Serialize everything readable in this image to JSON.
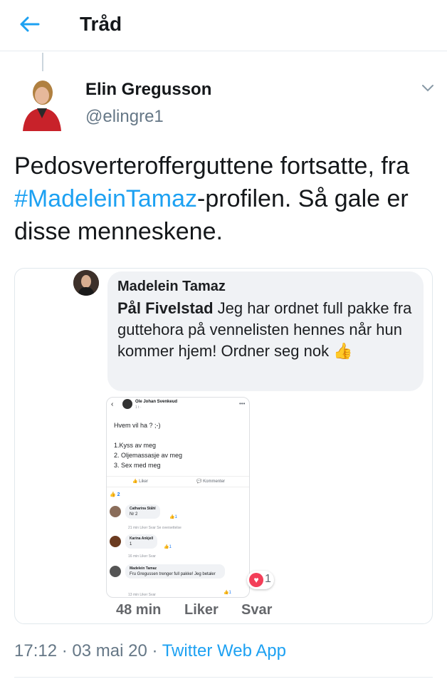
{
  "header": {
    "title": "Tråd",
    "back_icon": "back-arrow-icon"
  },
  "tweet": {
    "author_name": "Elin Gregusson",
    "author_handle": "@elingre1",
    "text_part1": "Pedosverteroffergutten​e fortsatte, fra ",
    "hashtag": "#MadeleinTamaz",
    "text_part2": "-profilen. Så gale er disse menneskene.",
    "timestamp": "17:12 · 03 mai 20 · ",
    "source": "Twitter Web App"
  },
  "media": {
    "commenter_name": "Madelein Tamaz",
    "mention": "Pål Fivelstad",
    "comment_text": " Jeg har ordnet full pakke fra guttehora på vennelisten hennes når hun kommer hjem! Ordner seg nok ",
    "meta_time": "48 min",
    "meta_like": "Liker",
    "meta_reply": "Svar",
    "reaction_count": "1",
    "embedded_post": {
      "author": "Ole Johan Svenkeud",
      "time": "1 t · ",
      "question": "Hvem vil ha ? ;-)",
      "list": [
        "1.Kyss av meg",
        "2. Oljemassasje av meg",
        "3. Sex med meg"
      ],
      "like_label": "Liker",
      "comment_label": "Kommenter",
      "reaction_count": "2",
      "comments": [
        {
          "name": "Catharina Ståhl",
          "text": "Nr 2",
          "meta": "21 min    Liker    Svar    Se oversettelse",
          "react": "1"
        },
        {
          "name": "Karina Ankjell",
          "text": "1",
          "meta": "16 min    Liker    Svar",
          "react": "1"
        },
        {
          "name": "Madelein Tamaz",
          "text": "Fru Gregussen trenger full pakke! Jeg betaler",
          "meta": "13 min    Liker    Svar",
          "react": "1"
        }
      ]
    }
  },
  "colors": {
    "accent": "#1da1f2",
    "text": "#14171a",
    "muted": "#657786",
    "heart": "#f33e58"
  }
}
